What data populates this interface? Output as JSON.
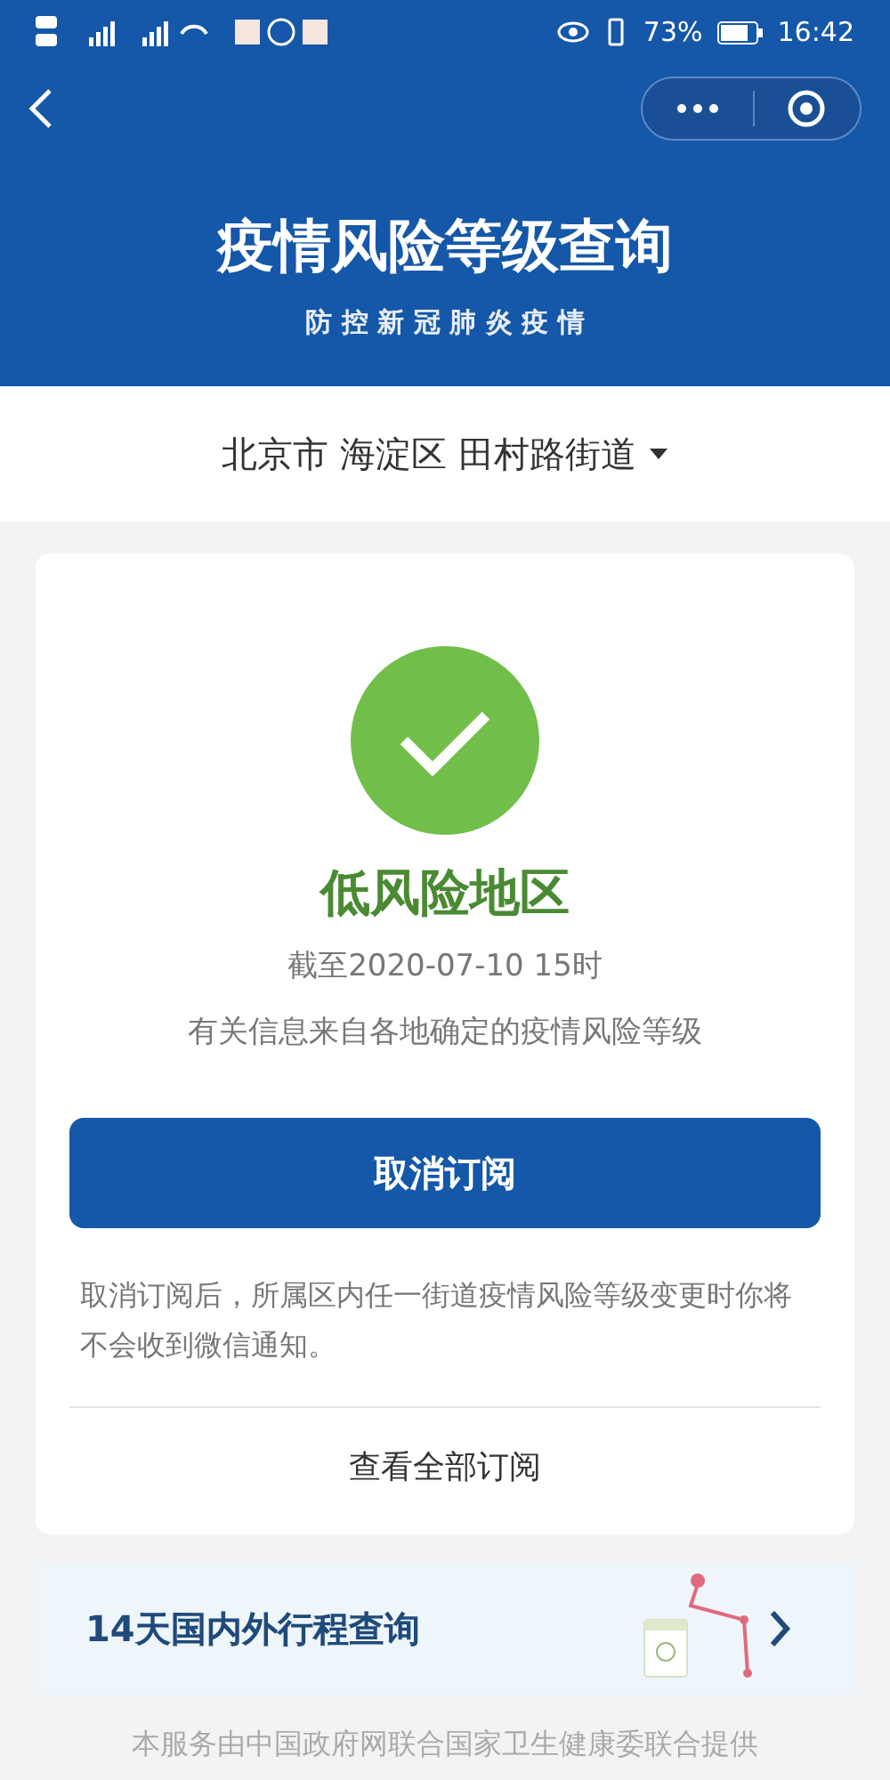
{
  "status_bar": {
    "battery": "73%",
    "time": "16:42"
  },
  "header": {
    "title": "疫情风险等级查询",
    "subtitle": "防 控 新 冠 肺 炎 疫 情"
  },
  "location": {
    "value": "北京市 海淀区 田村路街道"
  },
  "result": {
    "risk": "低风险地区",
    "as_of": "截至2020-07-10 15时",
    "source": "有关信息来自各地确定的疫情风险等级"
  },
  "unsubscribe_button": "取消订阅",
  "notice": "取消订阅后，所属区内任一街道疫情风险等级变更时你将不会收到微信通知。",
  "view_all_link": "查看全部订阅",
  "trip_card": {
    "title": "14天国内外行程查询"
  },
  "footer": "本服务由中国政府网联合国家卫生健康委联合提供"
}
